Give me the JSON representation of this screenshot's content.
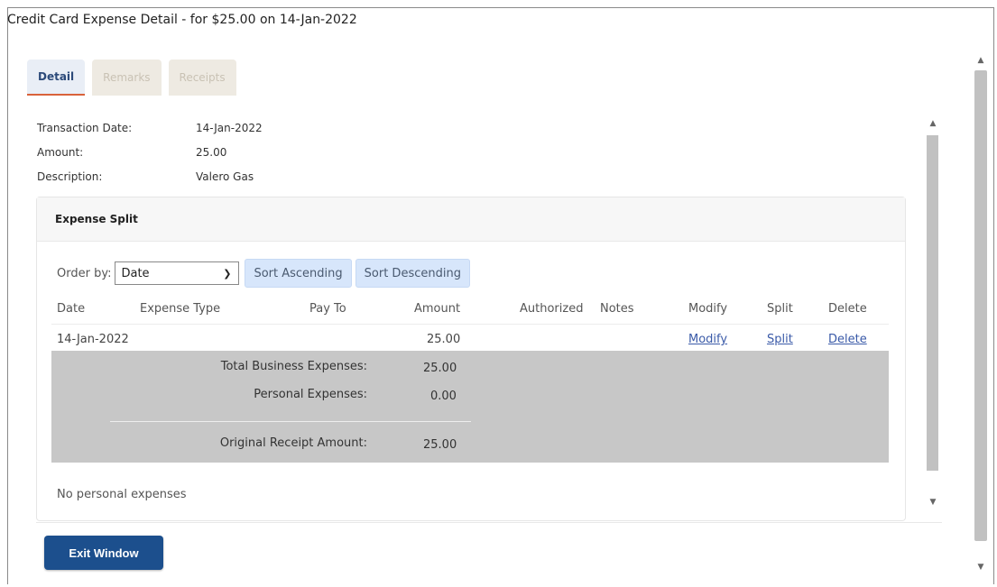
{
  "window": {
    "title": "Credit Card Expense Detail - for $25.00 on 14-Jan-2022"
  },
  "tabs": [
    {
      "label": "Detail",
      "active": true
    },
    {
      "label": "Remarks",
      "active": false
    },
    {
      "label": "Receipts",
      "active": false
    }
  ],
  "detail": {
    "transaction_date_label": "Transaction Date:",
    "transaction_date_value": "14-Jan-2022",
    "amount_label": "Amount:",
    "amount_value": "25.00",
    "description_label": "Description:",
    "description_value": "Valero Gas"
  },
  "expense_split": {
    "title": "Expense Split",
    "order_by_label": "Order by:",
    "order_by_selected": "Date",
    "sort_ascending_label": "Sort Ascending",
    "sort_descending_label": "Sort Descending",
    "columns": [
      "Date",
      "Expense Type",
      "Pay To",
      "Amount",
      "Authorized",
      "Notes",
      "Modify",
      "Split",
      "Delete"
    ],
    "rows": [
      {
        "date": "14-Jan-2022",
        "expense_type": "",
        "pay_to": "",
        "amount": "25.00",
        "authorized": "",
        "notes": "",
        "modify": "Modify",
        "split": "Split",
        "delete": "Delete"
      }
    ],
    "totals": {
      "business_label": "Total Business Expenses:",
      "business_value": "25.00",
      "personal_label": "Personal Expenses:",
      "personal_value": "0.00",
      "original_label": "Original Receipt Amount:",
      "original_value": "25.00"
    },
    "no_personal_text": "No personal expenses"
  },
  "footer": {
    "exit_label": "Exit Window"
  },
  "colors": {
    "exit_button": "#1c4f8d",
    "sort_button": "#d7e6fb",
    "totals_background": "#c7c7c7",
    "active_tab_underline": "#d9623a",
    "link": "#3a5aa8"
  }
}
